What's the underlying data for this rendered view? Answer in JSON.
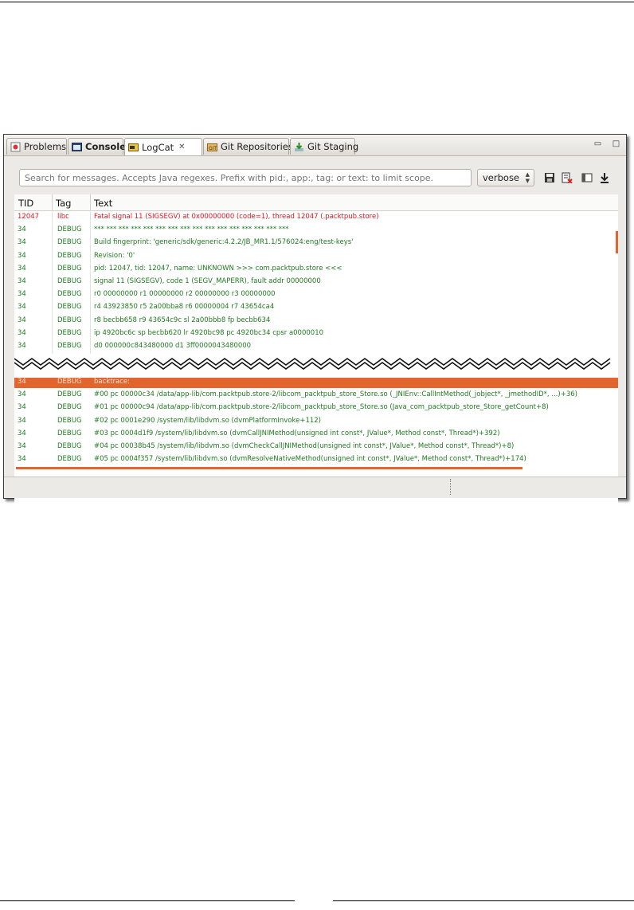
{
  "tabs": [
    {
      "label": "Problems",
      "icon": "problems-icon",
      "bold": false
    },
    {
      "label": "Console",
      "icon": "console-icon",
      "bold": true
    },
    {
      "label": "LogCat",
      "icon": "logcat-icon",
      "bold": false,
      "active": true
    },
    {
      "label": "Git Repositories",
      "icon": "git-repositories-icon",
      "bold": false
    },
    {
      "label": "Git Staging",
      "icon": "git-staging-icon",
      "bold": false
    }
  ],
  "window_controls": {
    "minimize": "▭",
    "maximize": "□"
  },
  "search": {
    "placeholder": "Search for messages. Accepts Java regexes. Prefix with pid:, app:, tag: or text: to limit scope."
  },
  "level": {
    "value": "verbose"
  },
  "toolbar_icons": [
    "save-icon",
    "clear-log-icon",
    "toggle-panel-icon",
    "scroll-lock-icon"
  ],
  "columns": {
    "tid": "TID",
    "tag": "Tag",
    "text": "Text"
  },
  "colors": {
    "error": "#e0151a",
    "debug": "#1f7a1f",
    "selection": "#e1652c"
  },
  "rows_top": [
    {
      "tid": "12047",
      "tag": "libc",
      "text": "Fatal signal 11 (SIGSEGV) at 0x00000000 (code=1), thread 12047 (.packtpub.store)",
      "level": "err"
    },
    {
      "tid": "34",
      "tag": "DEBUG",
      "text": "*** *** *** *** *** *** *** *** *** *** *** *** *** *** *** ***",
      "level": "debug"
    },
    {
      "tid": "34",
      "tag": "DEBUG",
      "text": "Build fingerprint: 'generic/sdk/generic:4.2.2/JB_MR1.1/576024:eng/test-keys'",
      "level": "debug"
    },
    {
      "tid": "34",
      "tag": "DEBUG",
      "text": "Revision: '0'",
      "level": "debug"
    },
    {
      "tid": "34",
      "tag": "DEBUG",
      "text": "pid: 12047, tid: 12047, name: UNKNOWN  >>> com.packtpub.store <<<",
      "level": "debug"
    },
    {
      "tid": "34",
      "tag": "DEBUG",
      "text": "signal 11 (SIGSEGV), code 1 (SEGV_MAPERR), fault addr 00000000",
      "level": "debug"
    },
    {
      "tid": "34",
      "tag": "DEBUG",
      "text": "    r0 00000000  r1 00000000  r2 00000000  r3 00000000",
      "level": "debug"
    },
    {
      "tid": "34",
      "tag": "DEBUG",
      "text": "    r4 43923850  r5 2a00bba8  r6 00000004  r7 43654ca4",
      "level": "debug"
    },
    {
      "tid": "34",
      "tag": "DEBUG",
      "text": "    r8 becbb658  r9 43654c9c  sl 2a00bbb8  fp becbb634",
      "level": "debug"
    },
    {
      "tid": "34",
      "tag": "DEBUG",
      "text": "    ip 4920bc6c  sp becbb620  lr 4920bc98  pc 4920bc34  cpsr a0000010",
      "level": "debug"
    },
    {
      "tid": "34",
      "tag": "DEBUG",
      "text": "    d0  000000c843480000  d1  3ff0000043480000",
      "level": "debug"
    }
  ],
  "rows_bottom": [
    {
      "tid": "34",
      "tag": "DEBUG",
      "text": "backtrace:",
      "level": "sel"
    },
    {
      "tid": "34",
      "tag": "DEBUG",
      "text": "    #00  pc 00000c34  /data/app-lib/com.packtpub.store-2/libcom_packtpub_store_Store.so (_JNIEnv::CallIntMethod(_jobject*, _jmethodID*, ...)+36)",
      "level": "debug"
    },
    {
      "tid": "34",
      "tag": "DEBUG",
      "text": "    #01  pc 00000c94  /data/app-lib/com.packtpub.store-2/libcom_packtpub_store_Store.so (Java_com_packtpub_store_Store_getCount+8)",
      "level": "debug"
    },
    {
      "tid": "34",
      "tag": "DEBUG",
      "text": "    #02  pc 0001e290  /system/lib/libdvm.so (dvmPlatformInvoke+112)",
      "level": "debug"
    },
    {
      "tid": "34",
      "tag": "DEBUG",
      "text": "    #03  pc 0004d1f9  /system/lib/libdvm.so (dvmCallJNIMethod(unsigned int const*, JValue*, Method const*, Thread*)+392)",
      "level": "debug"
    },
    {
      "tid": "34",
      "tag": "DEBUG",
      "text": "    #04  pc 00038b45  /system/lib/libdvm.so (dvmCheckCallJNIMethod(unsigned int const*, JValue*, Method const*, Thread*)+8)",
      "level": "debug"
    },
    {
      "tid": "34",
      "tag": "DEBUG",
      "text": "    #05  pc 0004f357  /system/lib/libdvm.so (dvmResolveNativeMethod(unsigned int const*, JValue*, Method const*, Thread*)+174)",
      "level": "debug"
    }
  ]
}
